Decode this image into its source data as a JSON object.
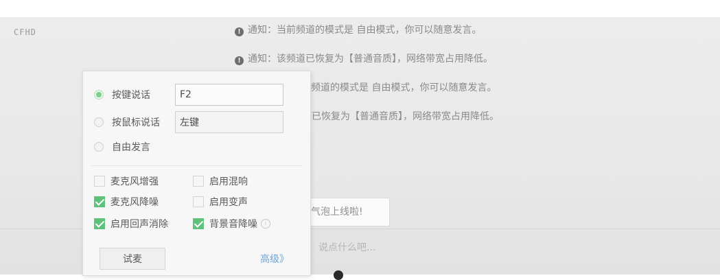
{
  "header": {
    "tag": "CFHD"
  },
  "notices": [
    {
      "label": "通知：",
      "text": "当前频道的模式是 自由模式，你可以随意发言。"
    },
    {
      "label": "通知：",
      "text": "该频道已恢复为【普通音质】，网络带宽占用降低。"
    },
    {
      "label": "",
      "text": "频道的模式是 自由模式，你可以随意发言。"
    },
    {
      "label": "",
      "text": "道已恢复为【普通音质】，网络带宽占用降低。"
    }
  ],
  "chat": {
    "bubble_text": "气泡上线啦!",
    "input_placeholder": "说点什么吧..."
  },
  "voice_panel": {
    "modes": [
      {
        "label": "按键说话",
        "value": "F2",
        "selected": true
      },
      {
        "label": "按鼠标说话",
        "value": "左键",
        "selected": false
      },
      {
        "label": "自由发言",
        "selected": false
      }
    ],
    "options": [
      {
        "label": "麦克风增强",
        "checked": false
      },
      {
        "label": "启用混响",
        "checked": false
      },
      {
        "label": "麦克风降噪",
        "checked": true
      },
      {
        "label": "启用变声",
        "checked": false
      },
      {
        "label": "启用回声消除",
        "checked": true
      },
      {
        "label": "背景音降噪",
        "checked": true
      }
    ],
    "test_button": "试麦",
    "advanced_link": "高级》"
  },
  "colors": {
    "accent_green": "#5fc27a",
    "link_blue": "#6ea4d8"
  }
}
